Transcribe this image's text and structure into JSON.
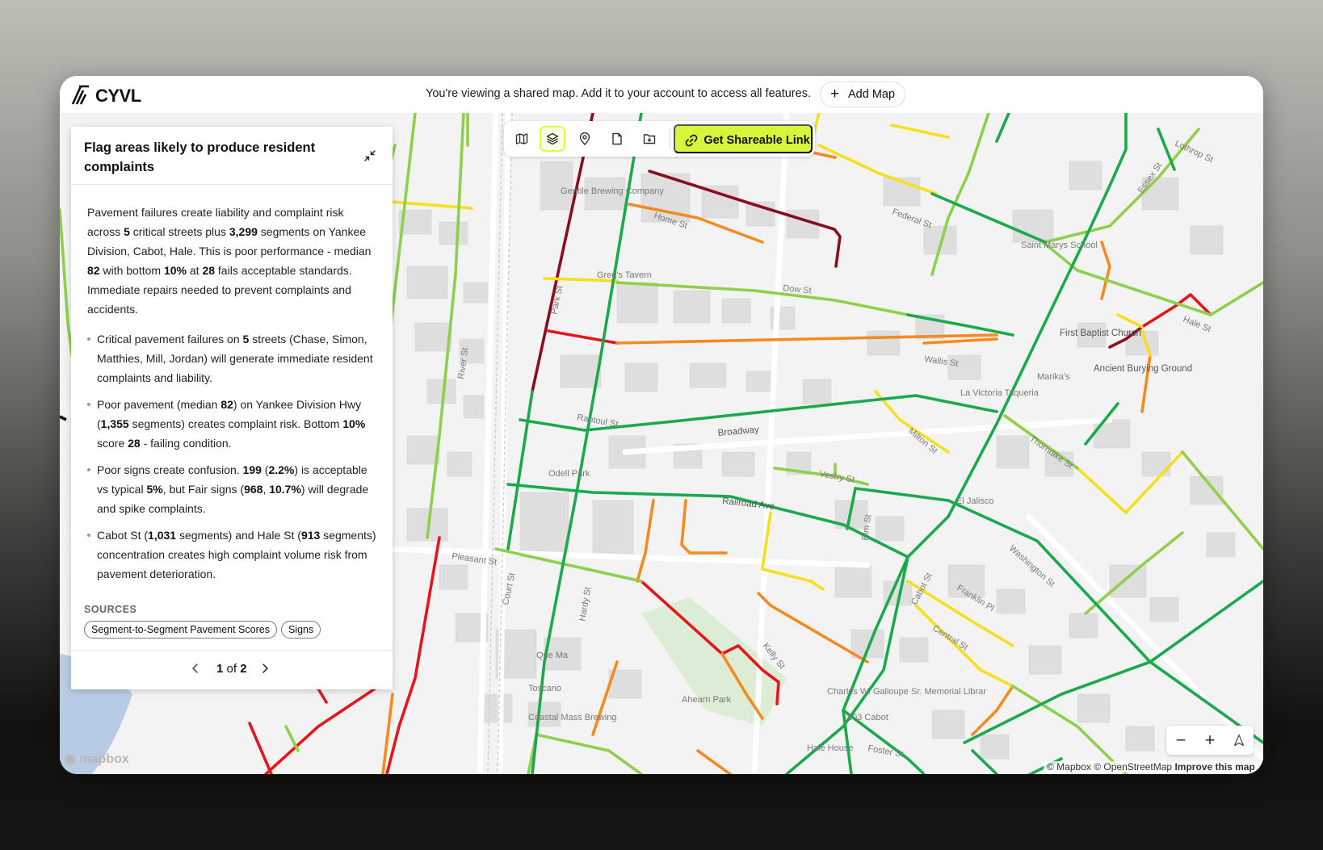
{
  "app": {
    "logo_text": "CYVL"
  },
  "banner": {
    "message": "You're viewing a shared map. Add it to your account to access all features.",
    "add_map_label": "Add Map"
  },
  "toolbar": {
    "tools": [
      {
        "icon": "map-icon",
        "active": false
      },
      {
        "icon": "layers-icon",
        "active": true
      },
      {
        "icon": "location-pin-icon",
        "active": false
      },
      {
        "icon": "document-icon",
        "active": false
      },
      {
        "icon": "folder-download-icon",
        "active": false
      }
    ],
    "share_label": "Get Shareable Link",
    "accent_color": "#d8f53b"
  },
  "panel": {
    "title": "Flag areas likely to produce resident complaints",
    "summary": [
      {
        "t": "Pavement failures create liability and complaint risk across "
      },
      {
        "b": "5"
      },
      {
        "t": " critical streets plus "
      },
      {
        "b": "3,299"
      },
      {
        "t": " segments on Yankee Division, Cabot, Hale. This is poor performance - median "
      },
      {
        "b": "82"
      },
      {
        "t": " with bottom "
      },
      {
        "b": "10%"
      },
      {
        "t": " at "
      },
      {
        "b": "28"
      },
      {
        "t": " fails acceptable standards. Immediate repairs needed to prevent complaints and accidents."
      }
    ],
    "bullets": [
      [
        {
          "t": "Critical pavement failures on "
        },
        {
          "b": "5"
        },
        {
          "t": " streets (Chase, Simon, Matthies, Mill, Jordan) will generate immediate resident complaints and liability."
        }
      ],
      [
        {
          "t": "Poor pavement (median "
        },
        {
          "b": "82"
        },
        {
          "t": ") on Yankee Division Hwy ("
        },
        {
          "b": "1,355"
        },
        {
          "t": " segments) creates complaint risk. Bottom "
        },
        {
          "b": "10%"
        },
        {
          "t": " score "
        },
        {
          "b": "28"
        },
        {
          "t": " - failing condition."
        }
      ],
      [
        {
          "t": "Poor signs create confusion. "
        },
        {
          "b": "199"
        },
        {
          "t": " ("
        },
        {
          "b": "2.2%"
        },
        {
          "t": ") is acceptable vs typical "
        },
        {
          "b": "5%"
        },
        {
          "t": ", but Fair signs ("
        },
        {
          "b": "968"
        },
        {
          "t": ", "
        },
        {
          "b": "10.7%"
        },
        {
          "t": ") will degrade and spike complaints."
        }
      ],
      [
        {
          "t": "Cabot St ("
        },
        {
          "b": "1,031"
        },
        {
          "t": " segments) and Hale St ("
        },
        {
          "b": "913"
        },
        {
          "t": " segments) concentration creates high complaint volume risk from pavement deterioration."
        }
      ]
    ],
    "sources_label": "SOURCES",
    "sources": [
      "Segment-to-Segment Pavement Scores",
      "Signs"
    ],
    "pager": {
      "current": "1",
      "of": "of",
      "total": "2"
    }
  },
  "map": {
    "labels": [
      "Gentile Brewing Company",
      "Greg's Tavern",
      "Odell Park",
      "Que Ma",
      "Toscano",
      "Coastal Mass Brewing",
      "Ahearn Park",
      "Charles W. Galloupe Sr. Memorial Librar",
      "103 Cabot",
      "Hale House",
      "El Jalisco",
      "La Victoria Taqueria",
      "Marika's",
      "First Baptist Church",
      "Ancient Burying Ground",
      "Saint Marys School",
      "Broadway",
      "Railroad Ave",
      "Pleasant St",
      "River St",
      "Federal St",
      "Wallis St",
      "Dow St",
      "Home St",
      "Hale St",
      "Cabot St",
      "Foster St",
      "Vestry St",
      "Elm St",
      "Central St",
      "Franklin Pl",
      "Milton St",
      "Thorndike St",
      "Washington St",
      "Rantoul St",
      "Park St",
      "Court St",
      "Kelly St",
      "Hardy St",
      "Essex St",
      "Lothrop St"
    ],
    "road_colors": {
      "good": "#1aaa4b",
      "fair": "#8ecf4b",
      "moderate": "#f7df1e",
      "poor": "#f58a1f",
      "failed": "#e4161b",
      "critical": "#8b0d1d"
    }
  },
  "controls": {
    "zoom_out": "−",
    "zoom_in": "+",
    "compass_icon": "compass-icon"
  },
  "attribution": {
    "logo": "mapbox",
    "mapbox": "© Mapbox",
    "osm": "© OpenStreetMap",
    "improve": "Improve this map"
  }
}
